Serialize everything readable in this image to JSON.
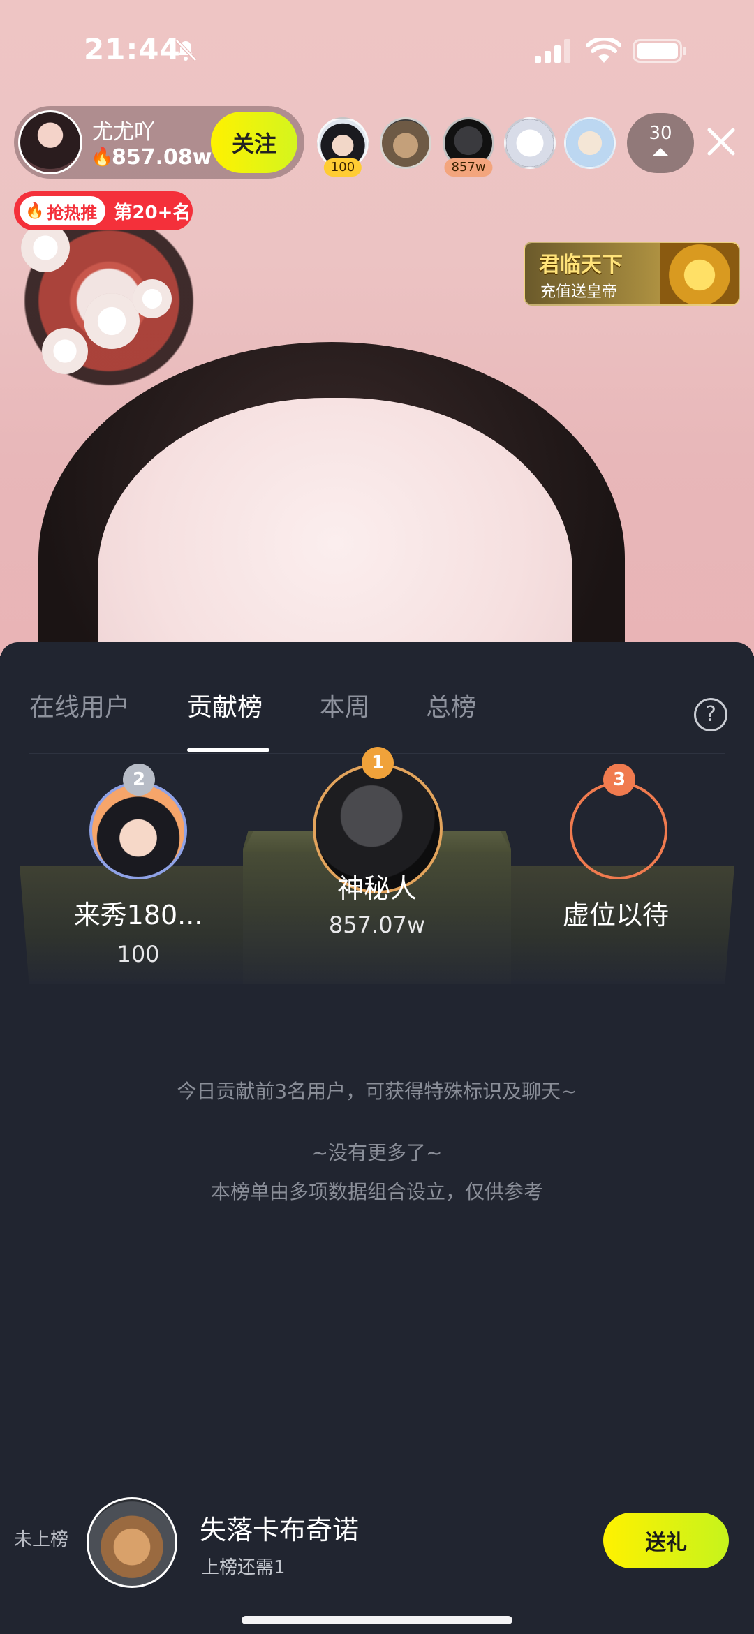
{
  "status_bar": {
    "time": "21:44"
  },
  "host": {
    "name": "尤尤吖",
    "score": "857.08w",
    "follow_label": "关注"
  },
  "viewers": [
    {
      "badge": "100",
      "badge_color": "#ffcc33",
      "color": "#f2d7c8"
    },
    {
      "badge": "",
      "badge_color": "",
      "color": "#a38a6c"
    },
    {
      "badge": "857w",
      "badge_color": "#f3a57d",
      "color": "#2a2a2e"
    },
    {
      "badge": "",
      "badge_color": "",
      "color": "#f3f3f7"
    },
    {
      "badge": "",
      "badge_color": "",
      "color": "#bcd7f1"
    }
  ],
  "viewer_count": "30",
  "hot_badge": {
    "label": "抢热推",
    "rank": "第20+名"
  },
  "promo": {
    "title": "君临天下",
    "subtitle": "充值送皇帝"
  },
  "sheet": {
    "tabs": [
      {
        "label": "在线用户",
        "active": false
      },
      {
        "label": "贡献榜",
        "active": true
      },
      {
        "label": "本周",
        "active": false
      },
      {
        "label": "总榜",
        "active": false
      }
    ],
    "help_label": "?",
    "podium": {
      "first": {
        "medal": "1",
        "name": "神秘人",
        "score": "857.07w"
      },
      "second": {
        "medal": "2",
        "name": "来秀180...",
        "score": "100"
      },
      "third": {
        "medal": "3",
        "name": "虚位以待",
        "score": ""
      }
    },
    "note_top3": "今日贡献前3名用户，可获得特殊标识及聊天~",
    "note_no_more": "~没有更多了~",
    "note_disclaimer": "本榜单由多项数据组合设立，仅供参考"
  },
  "me": {
    "status": "未上榜",
    "name": "失落卡布奇诺",
    "sub": "上榜还需1",
    "gift_label": "送礼"
  },
  "colors": {
    "accent_yellow": "#fff200",
    "sheet_bg": "#212530",
    "hot_red": "#f4303a",
    "gold_ring": "#e3a45c",
    "third_ring": "#f07b4f"
  }
}
